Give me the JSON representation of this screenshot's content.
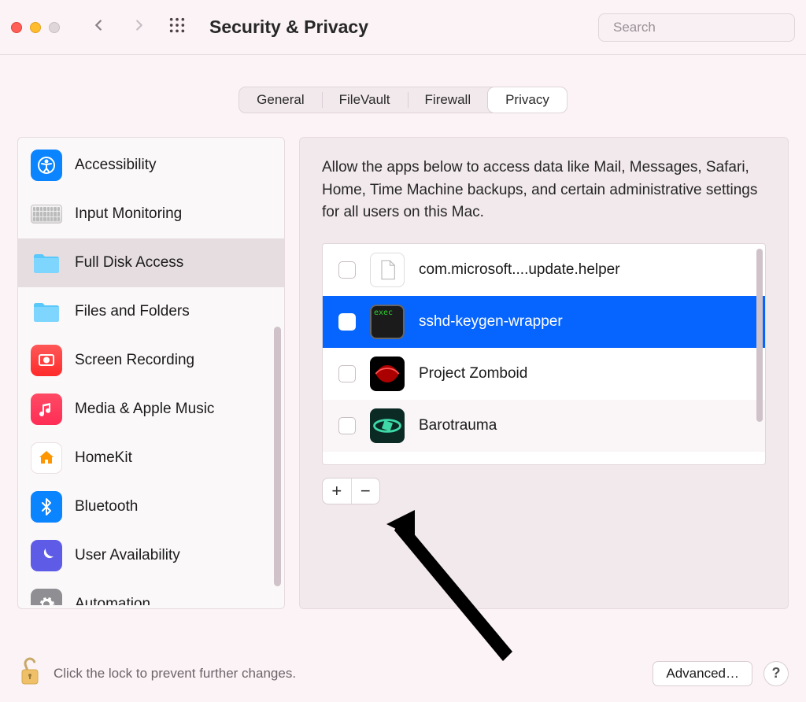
{
  "window": {
    "title": "Security & Privacy",
    "search_placeholder": "Search"
  },
  "tabs": {
    "items": [
      "General",
      "FileVault",
      "Firewall",
      "Privacy"
    ],
    "active": "Privacy"
  },
  "sidebar": {
    "items": [
      {
        "label": "Accessibility",
        "icon": "accessibility"
      },
      {
        "label": "Input Monitoring",
        "icon": "keyboard"
      },
      {
        "label": "Full Disk Access",
        "icon": "folder",
        "selected": true
      },
      {
        "label": "Files and Folders",
        "icon": "folder"
      },
      {
        "label": "Screen Recording",
        "icon": "screen-recording"
      },
      {
        "label": "Media & Apple Music",
        "icon": "music"
      },
      {
        "label": "HomeKit",
        "icon": "home"
      },
      {
        "label": "Bluetooth",
        "icon": "bluetooth"
      },
      {
        "label": "User Availability",
        "icon": "moon"
      },
      {
        "label": "Automation",
        "icon": "gear"
      }
    ]
  },
  "content": {
    "description": "Allow the apps below to access data like Mail, Messages, Safari, Home, Time Machine backups, and certain administrative settings for all users on this Mac.",
    "apps": [
      {
        "name": "com.microsoft....update.helper",
        "checked": false,
        "selected": false,
        "icon": "document"
      },
      {
        "name": "sshd-keygen-wrapper",
        "checked": false,
        "selected": true,
        "icon": "terminal"
      },
      {
        "name": "Project Zomboid",
        "checked": false,
        "selected": false,
        "icon": "zomboid"
      },
      {
        "name": "Barotrauma",
        "checked": false,
        "selected": false,
        "icon": "barotrauma"
      }
    ]
  },
  "footer": {
    "lock_text": "Click the lock to prevent further changes.",
    "advanced_label": "Advanced…",
    "help_label": "?"
  }
}
